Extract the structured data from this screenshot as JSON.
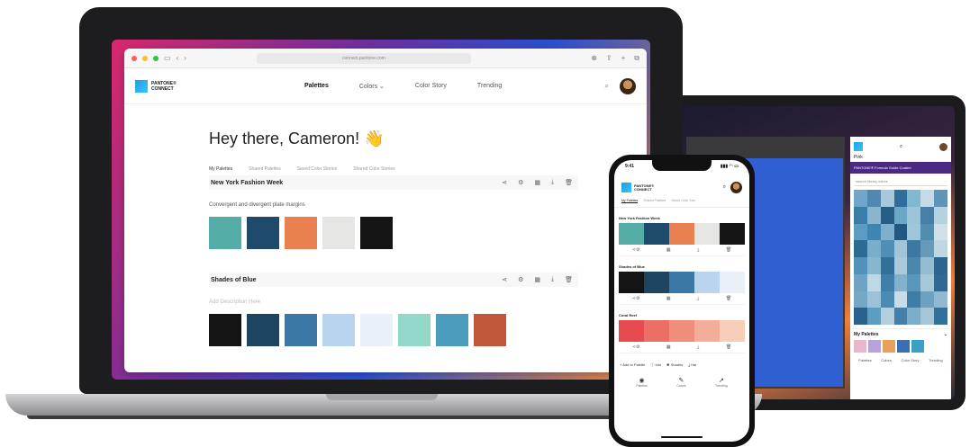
{
  "browser": {
    "url": "connect.pantone.com",
    "traffic_lights": [
      "#ff5f57",
      "#febc2e",
      "#28c840"
    ],
    "icons": [
      "sidebar-icon",
      "back-icon",
      "forward-icon",
      "shield-icon",
      "download-icon",
      "share-icon",
      "plus-icon",
      "tabs-icon"
    ]
  },
  "app": {
    "logo_text": "PANTONE® CONNECT",
    "nav": [
      "Palettes",
      "Colors ⌄",
      "Color Story",
      "Trending"
    ],
    "active_nav": "Palettes",
    "greeting": "Hey there, Cameron! 👋",
    "tabs": [
      "My Palettes",
      "Shared Palettes",
      "Saved Color Stories",
      "Shared Color Stories"
    ],
    "palettes": [
      {
        "title": "New York Fashion Week",
        "description": "Convergent and divergent plate margins",
        "swatches": [
          "#55ada8",
          "#1e4a6b",
          "#e9804f",
          "#e6e6e4",
          "#151515"
        ]
      },
      {
        "title": "Shades of Blue",
        "description": "Add Description Here",
        "swatches": [
          "#141414",
          "#1d4461",
          "#3b78a6",
          "#b8d4ee",
          "#eaf0f7",
          "#93d8c8",
          "#4b9bbd",
          "#c1573a"
        ]
      }
    ]
  },
  "phone": {
    "time": "9:41",
    "status_right": "▮▮▮ ◠ ▭",
    "tabs": [
      "My Palettes",
      "Shared Palettes",
      "Saved Color Stor"
    ],
    "palettes": [
      {
        "title": "New York Fashion Week",
        "swatches": [
          "#55ada8",
          "#1e4a6b",
          "#e9804f",
          "#e6e6e4",
          "#151515"
        ]
      },
      {
        "title": "Shades of Blue",
        "swatches": [
          "#141414",
          "#1d4461",
          "#3b78a6",
          "#b8d4ee",
          "#eaf0f7"
        ]
      },
      {
        "title": "Coral Reef",
        "swatches": [
          "#e64b4f",
          "#ec6f65",
          "#f08e7c",
          "#f3ad98",
          "#f5cdb9"
        ]
      }
    ],
    "bottom_actions": [
      "+ Add to Palette",
      "ⓘ Info",
      "✱ Shades",
      "⤓ Har"
    ],
    "nav": [
      "Palettes",
      "Colors",
      "Trending"
    ]
  },
  "tablet": {
    "app_title": "Pink",
    "banner": "PANTONE® Formula Guide Coated",
    "search_placeholder": "search library colors",
    "my_palettes_label": "My Palettes",
    "chips": [
      "#e9b7cb",
      "#b9a2d8",
      "#e6a15b",
      "#3a6fb3",
      "#3aa0c7"
    ],
    "nav": [
      "Palettes",
      "Colors",
      "Color Story",
      "Trending"
    ],
    "mosaic_colors": [
      "#6fa6c9",
      "#4f88b3",
      "#a6c9de",
      "#2f6e9a",
      "#7fb8cf",
      "#c4dbe6",
      "#5c95ba",
      "#3a7ea8",
      "#8ab5cf",
      "#2a5d86",
      "#6aa7c7",
      "#9cc4d8",
      "#467ea6",
      "#b5d2e0",
      "#5b9dc2",
      "#3e85b1",
      "#7db0cc",
      "#22587f",
      "#9ec7dc",
      "#518dae",
      "#cfe0e8",
      "#2d6b93",
      "#78aec9",
      "#4f8fb6",
      "#a2c6d8",
      "#3b78a2",
      "#6799bb",
      "#c0d7e3",
      "#5192ba",
      "#87b6cf",
      "#336f98",
      "#aac9da",
      "#4a86ad",
      "#94bdd4",
      "#2c6690",
      "#6ea3c3",
      "#bed8e4",
      "#3f7fa9",
      "#82b1cb",
      "#5997bd",
      "#a7c8da",
      "#2f6994",
      "#73a9c6",
      "#9bc2d6",
      "#4a8bb3",
      "#c8dde7",
      "#3d7ca5",
      "#6ea0c0",
      "#8fbad2",
      "#2b628b",
      "#5d9cc1",
      "#b1cfde",
      "#437fa8",
      "#7caecc",
      "#a5c6d8",
      "#31709a"
    ]
  }
}
